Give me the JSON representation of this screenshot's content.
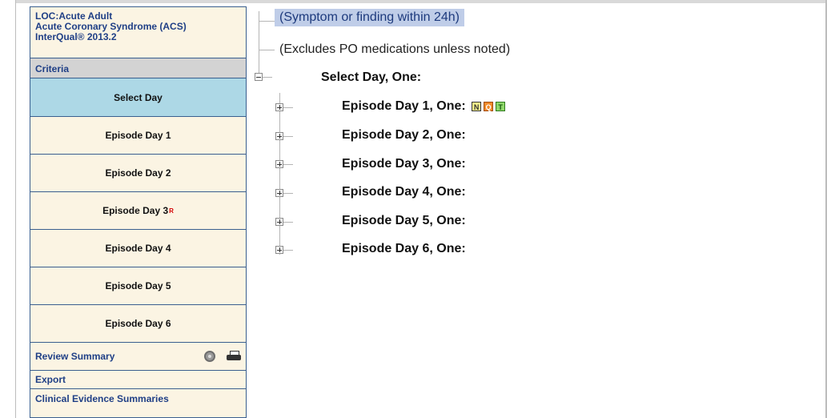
{
  "sidebar": {
    "header_lines": [
      "LOC:Acute Adult",
      "Acute Coronary Syndrome (ACS)",
      "InterQual® 2013.2"
    ],
    "criteria_label": "Criteria",
    "days": [
      {
        "label": "Select Day",
        "sup": "",
        "selected": true
      },
      {
        "label": "Episode Day 1",
        "sup": ""
      },
      {
        "label": "Episode Day 2",
        "sup": ""
      },
      {
        "label": "Episode Day 3",
        "sup": "R"
      },
      {
        "label": "Episode Day 4",
        "sup": ""
      },
      {
        "label": "Episode Day 5",
        "sup": ""
      },
      {
        "label": "Episode Day 6",
        "sup": ""
      }
    ],
    "review_summary": "Review Summary",
    "export": "Export",
    "clinical_evidence": "Clinical Evidence Summaries",
    "icons": [
      "gear-icon",
      "printer-icon"
    ]
  },
  "tree": {
    "line1": "(Symptom or finding within 24h)",
    "line2": "(Excludes PO medications unless noted)",
    "select_day": "Select Day, One:",
    "episodes": [
      "Episode Day 1, One:",
      "Episode Day 2, One:",
      "Episode Day 3, One:",
      "Episode Day 4, One:",
      "Episode Day 5, One:",
      "Episode Day 6, One:"
    ],
    "badges": [
      {
        "text": "N",
        "bg": "#f5f08a",
        "color": "#333"
      },
      {
        "text": "Q",
        "bg": "#f08a2a",
        "color": "#fff"
      },
      {
        "text": "T",
        "bg": "#8fd86a",
        "color": "#1a5c12"
      }
    ]
  },
  "colors": {
    "sidebar_bg": "#fbf4e3",
    "selected_bg": "#add8e6",
    "header_text": "#1f3f86",
    "superscript": "#d40000"
  }
}
